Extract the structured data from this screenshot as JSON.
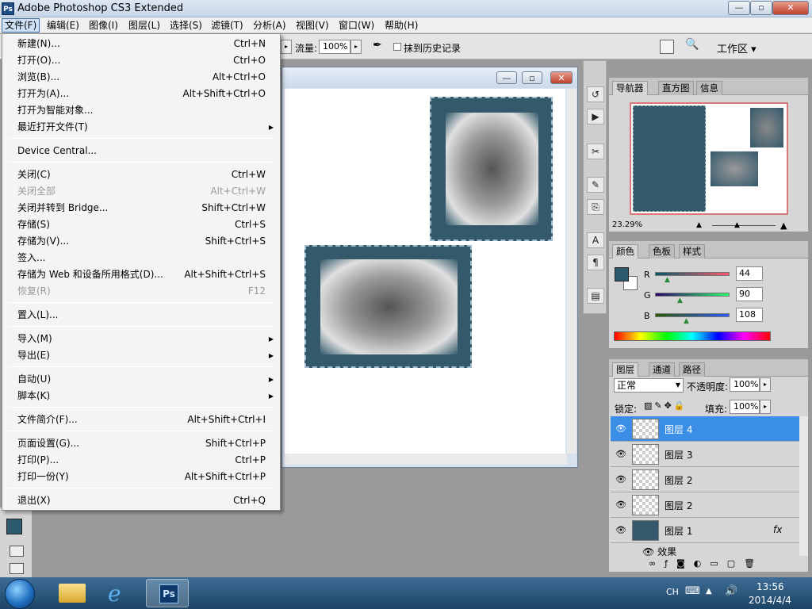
{
  "titlebar": {
    "logo": "Ps",
    "title": "Adobe Photoshop CS3 Extended"
  },
  "window_buttons": {
    "minimize": "—",
    "restore": "▫",
    "close": "✕"
  },
  "menubar": [
    "文件(F)",
    "编辑(E)",
    "图像(I)",
    "图层(L)",
    "选择(S)",
    "滤镜(T)",
    "分析(A)",
    "视图(V)",
    "窗口(W)",
    "帮助(H)"
  ],
  "optionsbar": {
    "flow_label": "流量:",
    "flow_value": "100%",
    "history_label": "抹到历史记录",
    "workspace_label": "工作区 ▾"
  },
  "file_menu": [
    {
      "label": "新建(N)...",
      "shortcut": "Ctrl+N"
    },
    {
      "label": "打开(O)...",
      "shortcut": "Ctrl+O"
    },
    {
      "label": "浏览(B)...",
      "shortcut": "Alt+Ctrl+O"
    },
    {
      "label": "打开为(A)...",
      "shortcut": "Alt+Shift+Ctrl+O"
    },
    {
      "label": "打开为智能对象...",
      "shortcut": ""
    },
    {
      "label": "最近打开文件(T)",
      "shortcut": "",
      "submenu": true
    },
    {
      "label": "Device Central...",
      "shortcut": ""
    },
    {
      "label": "关闭(C)",
      "shortcut": "Ctrl+W"
    },
    {
      "label": "关闭全部",
      "shortcut": "Alt+Ctrl+W",
      "disabled": true
    },
    {
      "label": "关闭并转到 Bridge...",
      "shortcut": "Shift+Ctrl+W"
    },
    {
      "label": "存储(S)",
      "shortcut": "Ctrl+S"
    },
    {
      "label": "存储为(V)...",
      "shortcut": "Shift+Ctrl+S"
    },
    {
      "label": "签入...",
      "shortcut": ""
    },
    {
      "label": "存储为 Web 和设备所用格式(D)...",
      "shortcut": "Alt+Shift+Ctrl+S"
    },
    {
      "label": "恢复(R)",
      "shortcut": "F12",
      "disabled": true
    },
    {
      "label": "置入(L)...",
      "shortcut": ""
    },
    {
      "label": "导入(M)",
      "shortcut": "",
      "submenu": true
    },
    {
      "label": "导出(E)",
      "shortcut": "",
      "submenu": true
    },
    {
      "label": "自动(U)",
      "shortcut": "",
      "submenu": true
    },
    {
      "label": "脚本(K)",
      "shortcut": "",
      "submenu": true
    },
    {
      "label": "文件简介(F)...",
      "shortcut": "Alt+Shift+Ctrl+I"
    },
    {
      "label": "页面设置(G)...",
      "shortcut": "Shift+Ctrl+P"
    },
    {
      "label": "打印(P)...",
      "shortcut": "Ctrl+P"
    },
    {
      "label": "打印一份(Y)",
      "shortcut": "Alt+Shift+Ctrl+P"
    },
    {
      "label": "退出(X)",
      "shortcut": "Ctrl+Q"
    }
  ],
  "navigator_panel": {
    "tabs": [
      "导航器",
      "直方图",
      "信息"
    ],
    "zoom": "23.29%"
  },
  "color_panel": {
    "tabs": [
      "颜色",
      "色板",
      "样式"
    ],
    "r_label": "R",
    "g_label": "G",
    "b_label": "B",
    "r": "44",
    "g": "90",
    "b": "108",
    "foreground_color": "#2c5a6c"
  },
  "layers_panel": {
    "tabs": [
      "图层",
      "通道",
      "路径"
    ],
    "blend_mode": "正常",
    "opacity_label": "不透明度:",
    "opacity": "100%",
    "lock_label": "锁定:",
    "fill_label": "填充:",
    "fill": "100%",
    "layers": [
      {
        "name": "图层 4",
        "selected": true
      },
      {
        "name": "图层 3"
      },
      {
        "name": "图层 2"
      },
      {
        "name": "图层 2"
      },
      {
        "name": "图层 1",
        "fx": "fx"
      }
    ],
    "effects_label": "效果"
  },
  "taskbar": {
    "lang": "CH",
    "time": "13:56",
    "date": "2014/4/4"
  }
}
